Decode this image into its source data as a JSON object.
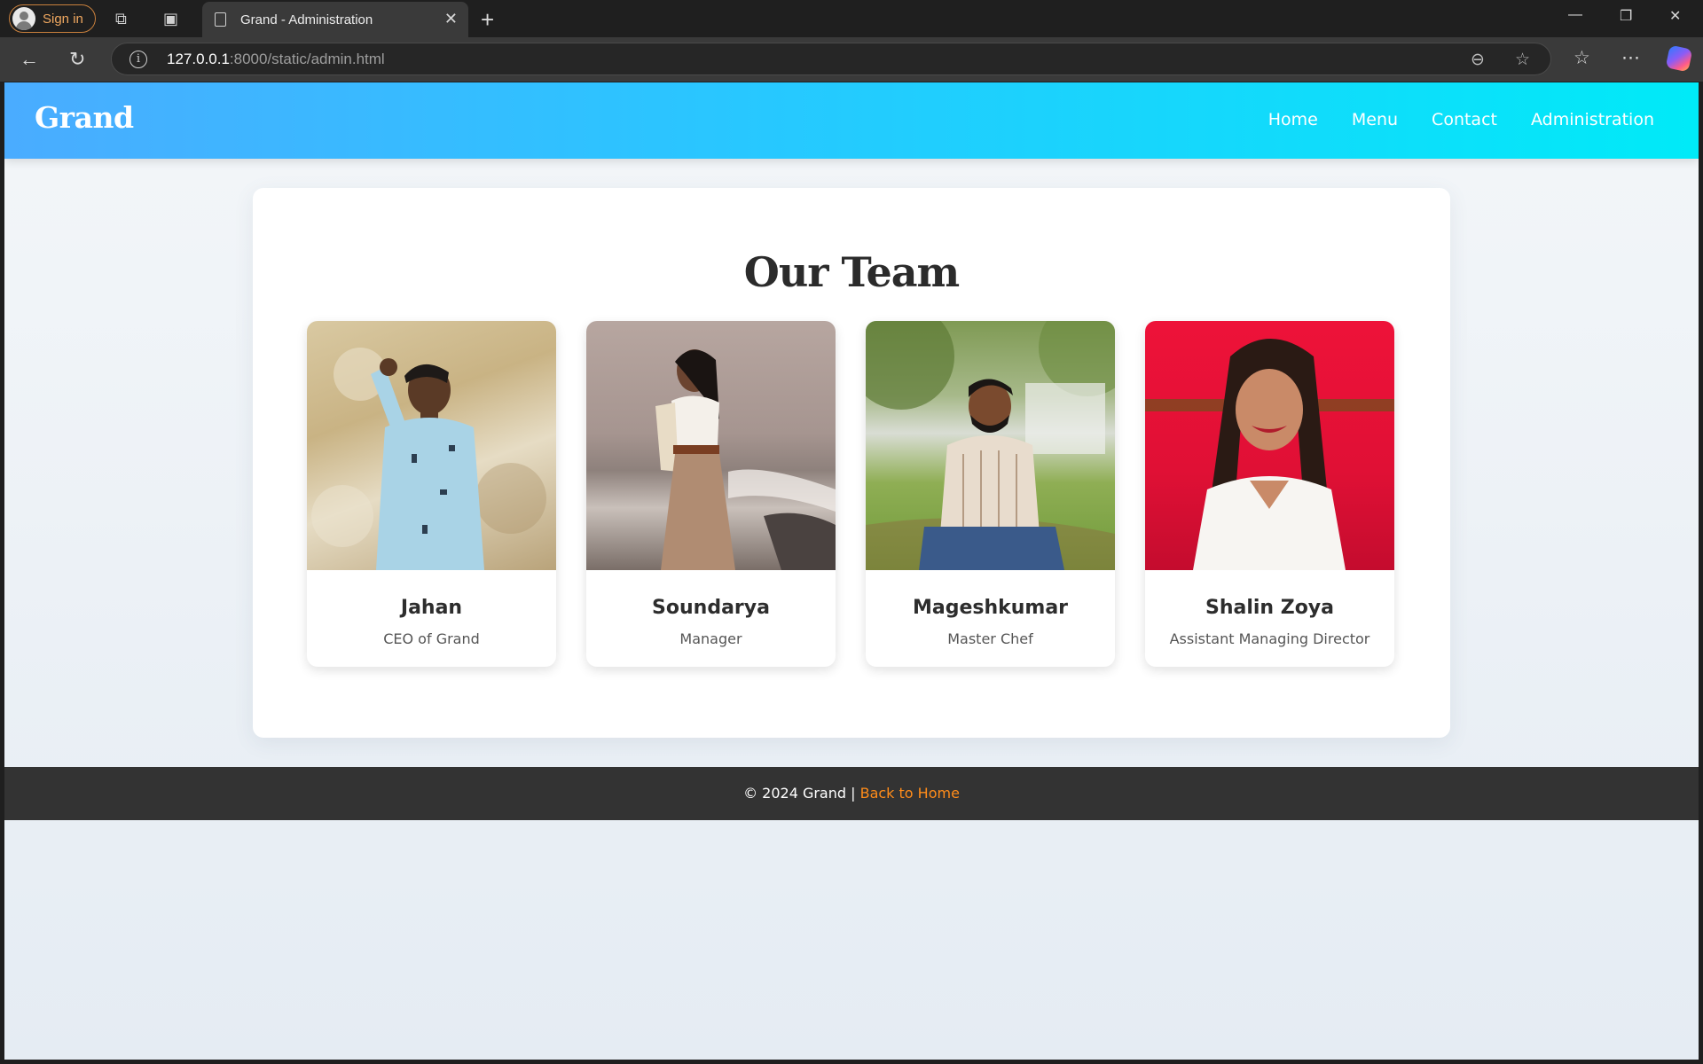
{
  "browser": {
    "signin_label": "Sign in",
    "tab_title": "Grand - Administration",
    "url_host": "127.0.0.1",
    "url_path": ":8000/static/admin.html"
  },
  "site": {
    "brand": "Grand",
    "nav": [
      "Home",
      "Menu",
      "Contact",
      "Administration"
    ]
  },
  "team": {
    "title": "Our Team",
    "members": [
      {
        "name": "Jahan",
        "role": "CEO of Grand"
      },
      {
        "name": "Soundarya",
        "role": "Manager"
      },
      {
        "name": "Mageshkumar",
        "role": "Master Chef"
      },
      {
        "name": "Shalin Zoya",
        "role": "Assistant Managing Director"
      }
    ]
  },
  "footer": {
    "copyright": "© 2024 Grand | ",
    "link_label": "Back to Home"
  }
}
